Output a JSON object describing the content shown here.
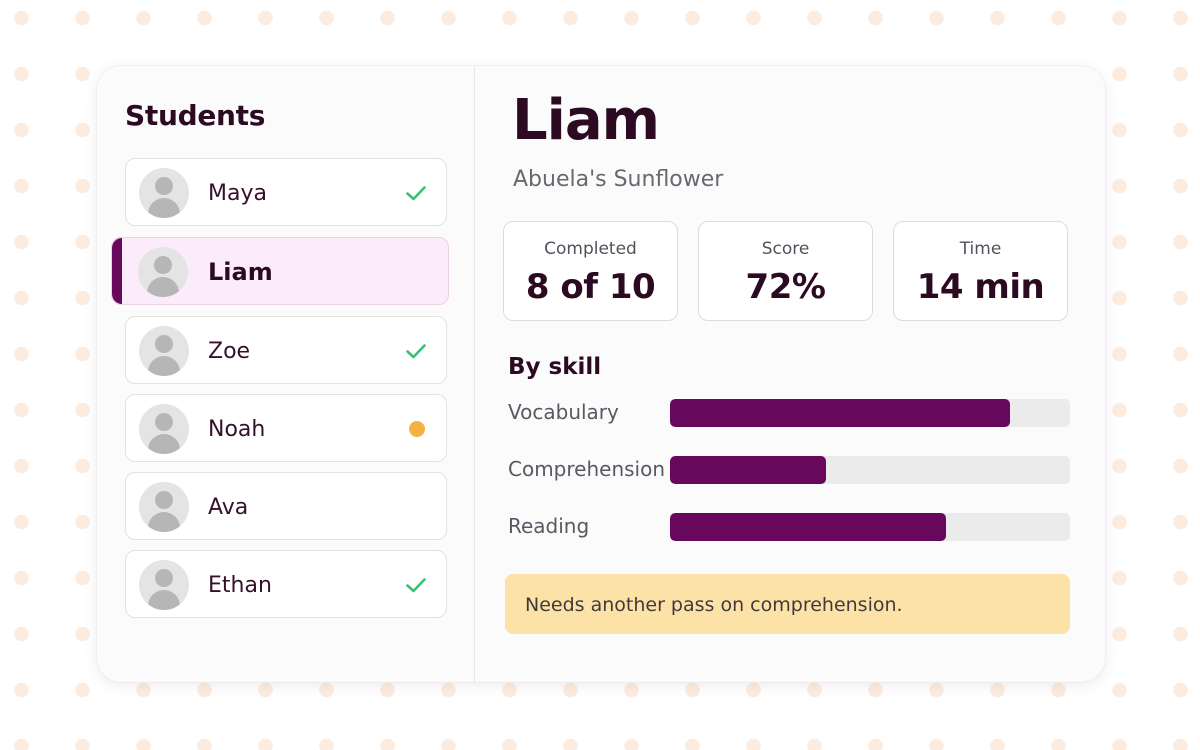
{
  "sidebar": {
    "title": "Students",
    "students": [
      {
        "name": "Maya",
        "status": "complete",
        "selected": false
      },
      {
        "name": "Liam",
        "status": "none",
        "selected": true
      },
      {
        "name": "Zoe",
        "status": "complete",
        "selected": false
      },
      {
        "name": "Noah",
        "status": "in-progress",
        "selected": false
      },
      {
        "name": "Ava",
        "status": "none",
        "selected": false
      },
      {
        "name": "Ethan",
        "status": "complete",
        "selected": false
      }
    ]
  },
  "detail": {
    "student_name": "Liam",
    "book_title": "Abuela's Sunflower",
    "stats": [
      {
        "label": "Completed",
        "value": "8 of 10"
      },
      {
        "label": "Score",
        "value": "72%"
      },
      {
        "label": "Time",
        "value": "14 min"
      }
    ],
    "skills_heading": "By skill",
    "skills": [
      {
        "label": "Vocabulary",
        "level": 0.85
      },
      {
        "label": "Comprehension",
        "level": 0.39
      },
      {
        "label": "Reading",
        "level": 0.69
      }
    ],
    "note": "Needs another pass on comprehension."
  },
  "colors": {
    "accent": "#68085c",
    "check": "#3bbf78",
    "in_progress": "#f4b144",
    "note_background": "#fde2a8"
  },
  "icons": {
    "complete": "checkmark-icon",
    "in_progress": "dot-icon"
  }
}
